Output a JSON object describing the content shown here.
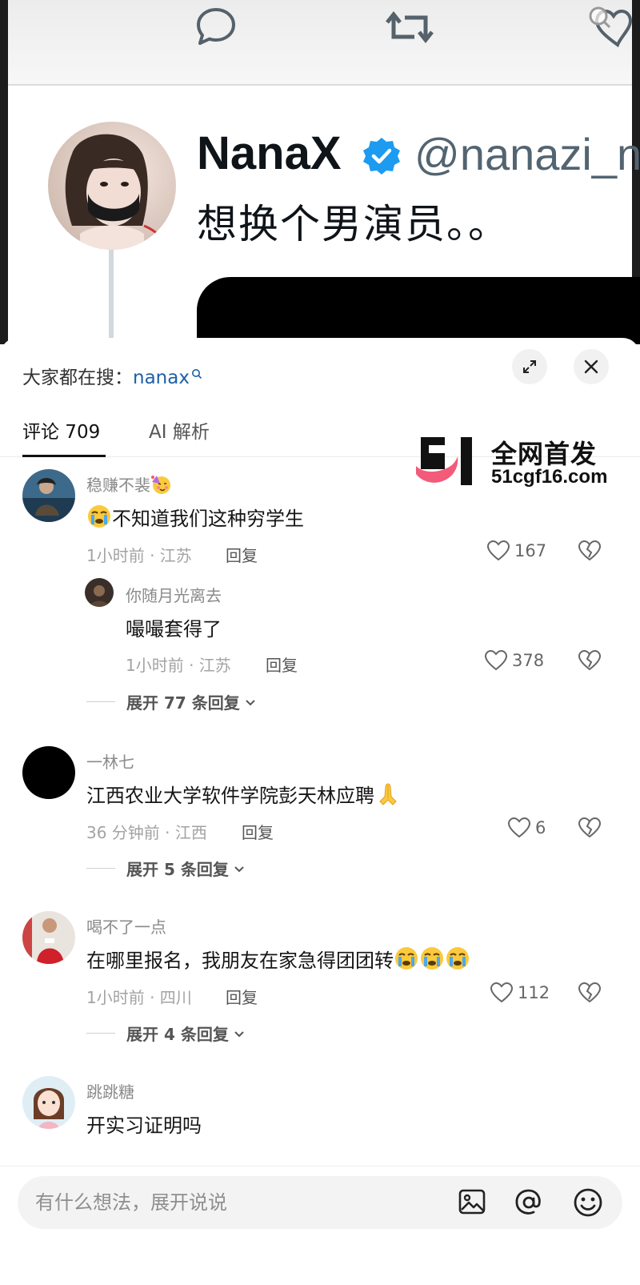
{
  "tweet": {
    "name": "NanaX",
    "handle": "@nanazi_n",
    "text": "想换个男演员。。",
    "icons": [
      "comment-icon",
      "retweet-icon",
      "like-icon",
      "zoom-icon",
      "verified-badge-icon"
    ]
  },
  "sheet": {
    "search_label": "大家都在搜：",
    "search_keyword": "nanax",
    "tabs": [
      {
        "label": "评论 709",
        "active": true
      },
      {
        "label": "AI 解析",
        "active": false
      }
    ],
    "watermark": {
      "line1": "全网首发",
      "line2": "51cgf16.com"
    }
  },
  "comments": [
    {
      "user": "稳赚不裴",
      "user_emoji": "party-face-emoji",
      "text": "不知道我们这种穷学生",
      "text_emoji": "crying-face-emoji",
      "meta": "1小时前 · 江苏",
      "reply_label": "回复",
      "likes": "167",
      "replies": [
        {
          "user": "你随月光离去",
          "text": "嘬嘬套得了",
          "meta": "1小时前 · 江苏",
          "reply_label": "回复",
          "likes": "378"
        }
      ],
      "expand_label": "展开 77 条回复"
    },
    {
      "user": "一林七",
      "text": "江西农业大学软件学院彭天林应聘",
      "text_emoji": "folded-hands-emoji",
      "meta": "36 分钟前 · 江西",
      "reply_label": "回复",
      "likes": "6",
      "expand_label": "展开 5 条回复"
    },
    {
      "user": "喝不了一点",
      "text": "在哪里报名，我朋友在家急得团团转",
      "text_emoji": "crying-face-emoji x3",
      "meta": "1小时前 · 四川",
      "reply_label": "回复",
      "likes": "112",
      "expand_label": "展开 4 条回复"
    },
    {
      "user": "跳跳糖",
      "text": "开实习证明吗"
    }
  ],
  "input": {
    "placeholder": "有什么想法，展开说说",
    "icons": [
      "image-icon",
      "at-icon",
      "emoji-icon"
    ]
  },
  "colors": {
    "link": "#1d5fa8",
    "muted": "#a3a3a3",
    "tweet_text": "#0f1419",
    "verified": "#1d9bf0"
  }
}
